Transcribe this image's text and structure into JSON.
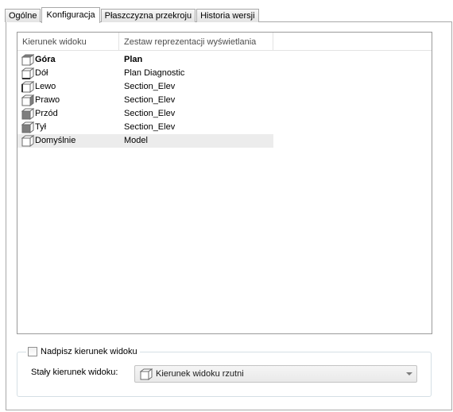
{
  "tabs": [
    {
      "label": "Ogólne",
      "active": false
    },
    {
      "label": "Konfiguracja",
      "active": true
    },
    {
      "label": "Płaszczyzna przekroju",
      "active": false
    },
    {
      "label": "Historia wersji",
      "active": false
    }
  ],
  "table": {
    "columns": [
      "Kierunek widoku",
      "Zestaw reprezentacji wyświetlania"
    ],
    "rows": [
      {
        "icon": "cube-top-icon",
        "direction": "Góra",
        "display_set": "Plan",
        "bold": true,
        "selected": false
      },
      {
        "icon": "cube-bottom-icon",
        "direction": "Dół",
        "display_set": "Plan Diagnostic",
        "bold": false,
        "selected": false
      },
      {
        "icon": "cube-left-icon",
        "direction": "Lewo",
        "display_set": "Section_Elev",
        "bold": false,
        "selected": false
      },
      {
        "icon": "cube-right-icon",
        "direction": "Prawo",
        "display_set": "Section_Elev",
        "bold": false,
        "selected": false
      },
      {
        "icon": "cube-front-icon",
        "direction": "Przód",
        "display_set": "Section_Elev",
        "bold": false,
        "selected": false
      },
      {
        "icon": "cube-back-icon",
        "direction": "Tył",
        "display_set": "Section_Elev",
        "bold": false,
        "selected": false
      },
      {
        "icon": "cube-default-icon",
        "direction": "Domyślnie",
        "display_set": "Model",
        "bold": false,
        "selected": true
      }
    ]
  },
  "override": {
    "checkbox_label": "Nadpisz kierunek widoku",
    "checked": false,
    "fixed_label": "Stały kierunek widoku:",
    "combo_value": "Kierunek widoku rzutni",
    "combo_icon": "cube-default-icon"
  }
}
